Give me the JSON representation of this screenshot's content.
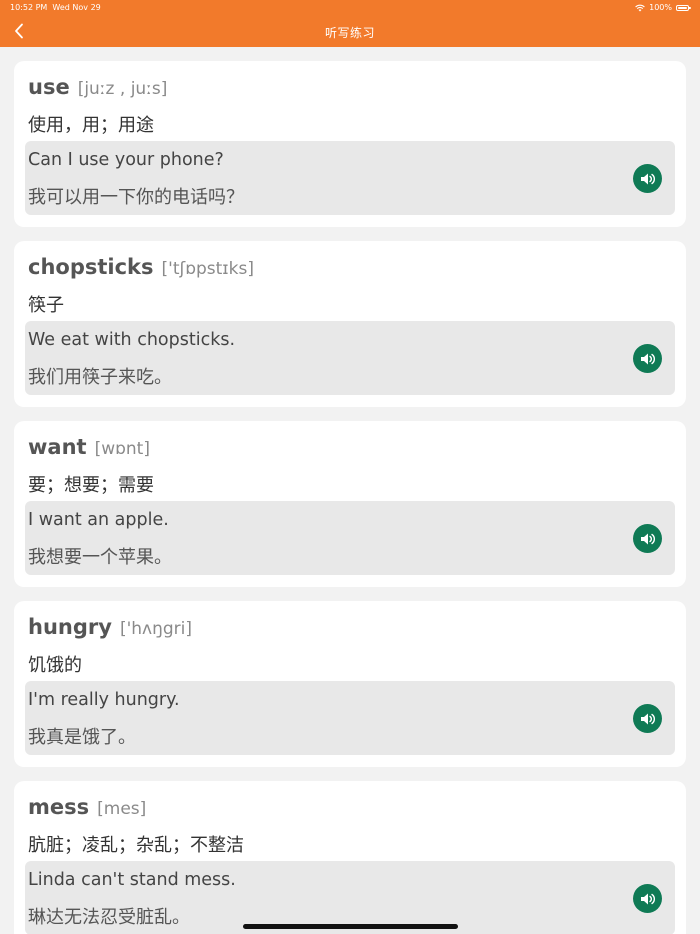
{
  "status_bar": {
    "time": "10:52 PM",
    "date": "Wed Nov 29",
    "battery": "100%",
    "wifi_icon": "wifi-icon",
    "battery_icon": "battery-icon"
  },
  "nav": {
    "title": "听写练习",
    "back_icon": "chevron-left-icon",
    "color": "#f27a2b"
  },
  "cards": [
    {
      "word": "use",
      "phonetic": "[juːz , juːs]",
      "meaning": "使用，用；用途",
      "example_en": "Can I use your phone?",
      "example_zh": "我可以用一下你的电话吗？"
    },
    {
      "word": "chopsticks",
      "phonetic": "['tʃɒpstɪks]",
      "meaning": "筷子",
      "example_en": "We eat with chopsticks.",
      "example_zh": "我们用筷子来吃。"
    },
    {
      "word": "want",
      "phonetic": "[wɒnt]",
      "meaning": "要；想要；需要",
      "example_en": "I want an apple.",
      "example_zh": "我想要一个苹果。"
    },
    {
      "word": "hungry",
      "phonetic": "['hʌŋgri]",
      "meaning": "饥饿的",
      "example_en": "I'm really hungry.",
      "example_zh": "我真是饿了。"
    },
    {
      "word": "mess",
      "phonetic": "[mes]",
      "meaning": "肮脏；凌乱；杂乱；不整洁",
      "example_en": "Linda can't stand mess.",
      "example_zh": "琳达无法忍受脏乱。"
    }
  ],
  "sound_icon": "speaker-icon",
  "sound_button_color": "#0f7a55"
}
